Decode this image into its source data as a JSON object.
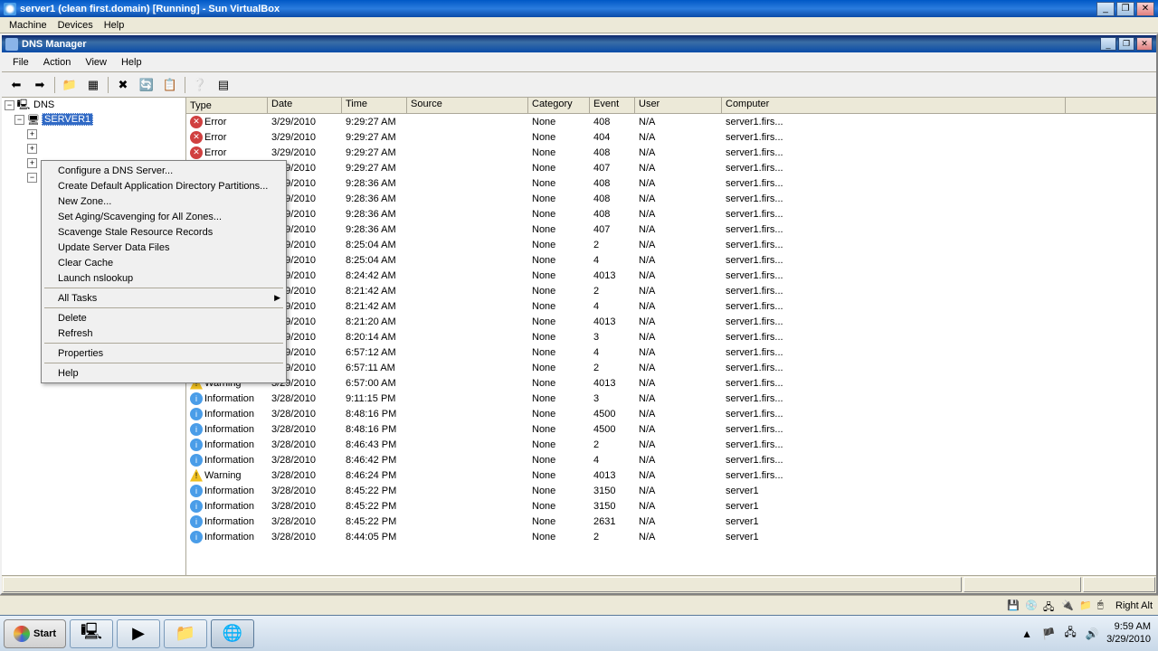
{
  "vbox": {
    "title": "server1 (clean first.domain) [Running] - Sun VirtualBox",
    "menu": {
      "machine": "Machine",
      "devices": "Devices",
      "help": "Help"
    },
    "status_key": "Right Alt"
  },
  "dns_window": {
    "title": "DNS Manager",
    "menu": {
      "file": "File",
      "action": "Action",
      "view": "View",
      "help": "Help"
    }
  },
  "tree": {
    "root": "DNS",
    "server": "SERVER1"
  },
  "context_menu": {
    "configure": "Configure a DNS Server...",
    "create_partitions": "Create Default Application Directory Partitions...",
    "new_zone": "New Zone...",
    "aging": "Set Aging/Scavenging for All Zones...",
    "scavenge": "Scavenge Stale Resource Records",
    "update": "Update Server Data Files",
    "clear_cache": "Clear Cache",
    "nslookup": "Launch nslookup",
    "all_tasks": "All Tasks",
    "delete": "Delete",
    "refresh": "Refresh",
    "properties": "Properties",
    "help": "Help"
  },
  "columns": {
    "type": "Type",
    "date": "Date",
    "time": "Time",
    "source": "Source",
    "category": "Category",
    "event": "Event",
    "user": "User",
    "computer": "Computer"
  },
  "type_labels": {
    "info": "Information",
    "warn": "Warning",
    "error": "Error"
  },
  "rows": [
    {
      "t": "error",
      "date": "3/29/2010",
      "time": "9:29:27 AM",
      "src": "",
      "cat": "None",
      "ev": "408",
      "u": "N/A",
      "c": "server1.firs..."
    },
    {
      "t": "error",
      "date": "3/29/2010",
      "time": "9:29:27 AM",
      "src": "",
      "cat": "None",
      "ev": "404",
      "u": "N/A",
      "c": "server1.firs..."
    },
    {
      "t": "error",
      "date": "3/29/2010",
      "time": "9:29:27 AM",
      "src": "",
      "cat": "None",
      "ev": "408",
      "u": "N/A",
      "c": "server1.firs..."
    },
    {
      "t": "error",
      "date": "3/29/2010",
      "time": "9:29:27 AM",
      "src": "",
      "cat": "None",
      "ev": "407",
      "u": "N/A",
      "c": "server1.firs..."
    },
    {
      "t": "error",
      "date": "3/29/2010",
      "time": "9:28:36 AM",
      "src": "",
      "cat": "None",
      "ev": "408",
      "u": "N/A",
      "c": "server1.firs..."
    },
    {
      "t": "error",
      "date": "3/29/2010",
      "time": "9:28:36 AM",
      "src": "",
      "cat": "None",
      "ev": "408",
      "u": "N/A",
      "c": "server1.firs..."
    },
    {
      "t": "error",
      "date": "3/29/2010",
      "time": "9:28:36 AM",
      "src": "",
      "cat": "None",
      "ev": "408",
      "u": "N/A",
      "c": "server1.firs..."
    },
    {
      "t": "error",
      "date": "3/29/2010",
      "time": "9:28:36 AM",
      "src": "",
      "cat": "None",
      "ev": "407",
      "u": "N/A",
      "c": "server1.firs..."
    },
    {
      "t": "info",
      "date": "3/29/2010",
      "time": "8:25:04 AM",
      "src": "",
      "cat": "None",
      "ev": "2",
      "u": "N/A",
      "c": "server1.firs..."
    },
    {
      "t": "info",
      "date": "3/29/2010",
      "time": "8:25:04 AM",
      "src": "",
      "cat": "None",
      "ev": "4",
      "u": "N/A",
      "c": "server1.firs..."
    },
    {
      "t": "warn",
      "date": "3/29/2010",
      "time": "8:24:42 AM",
      "src": "",
      "cat": "None",
      "ev": "4013",
      "u": "N/A",
      "c": "server1.firs..."
    },
    {
      "t": "info",
      "date": "3/29/2010",
      "time": "8:21:42 AM",
      "src": "",
      "cat": "None",
      "ev": "2",
      "u": "N/A",
      "c": "server1.firs..."
    },
    {
      "t": "info",
      "date": "3/29/2010",
      "time": "8:21:42 AM",
      "src": "",
      "cat": "None",
      "ev": "4",
      "u": "N/A",
      "c": "server1.firs..."
    },
    {
      "t": "warn",
      "date": "3/29/2010",
      "time": "8:21:20 AM",
      "src": "",
      "cat": "None",
      "ev": "4013",
      "u": "N/A",
      "c": "server1.firs..."
    },
    {
      "t": "info",
      "date": "3/29/2010",
      "time": "8:20:14 AM",
      "src": "",
      "cat": "None",
      "ev": "3",
      "u": "N/A",
      "c": "server1.firs..."
    },
    {
      "t": "info",
      "date": "3/29/2010",
      "time": "6:57:12 AM",
      "src": "",
      "cat": "None",
      "ev": "4",
      "u": "N/A",
      "c": "server1.firs..."
    },
    {
      "t": "info",
      "date": "3/29/2010",
      "time": "6:57:11 AM",
      "src": "",
      "cat": "None",
      "ev": "2",
      "u": "N/A",
      "c": "server1.firs..."
    },
    {
      "t": "warn",
      "date": "3/29/2010",
      "time": "6:57:00 AM",
      "src": "",
      "cat": "None",
      "ev": "4013",
      "u": "N/A",
      "c": "server1.firs..."
    },
    {
      "t": "info",
      "date": "3/28/2010",
      "time": "9:11:15 PM",
      "src": "",
      "cat": "None",
      "ev": "3",
      "u": "N/A",
      "c": "server1.firs..."
    },
    {
      "t": "info",
      "date": "3/28/2010",
      "time": "8:48:16 PM",
      "src": "",
      "cat": "None",
      "ev": "4500",
      "u": "N/A",
      "c": "server1.firs..."
    },
    {
      "t": "info",
      "date": "3/28/2010",
      "time": "8:48:16 PM",
      "src": "",
      "cat": "None",
      "ev": "4500",
      "u": "N/A",
      "c": "server1.firs..."
    },
    {
      "t": "info",
      "date": "3/28/2010",
      "time": "8:46:43 PM",
      "src": "",
      "cat": "None",
      "ev": "2",
      "u": "N/A",
      "c": "server1.firs..."
    },
    {
      "t": "info",
      "date": "3/28/2010",
      "time": "8:46:42 PM",
      "src": "",
      "cat": "None",
      "ev": "4",
      "u": "N/A",
      "c": "server1.firs..."
    },
    {
      "t": "warn",
      "date": "3/28/2010",
      "time": "8:46:24 PM",
      "src": "",
      "cat": "None",
      "ev": "4013",
      "u": "N/A",
      "c": "server1.firs..."
    },
    {
      "t": "info",
      "date": "3/28/2010",
      "time": "8:45:22 PM",
      "src": "",
      "cat": "None",
      "ev": "3150",
      "u": "N/A",
      "c": "server1"
    },
    {
      "t": "info",
      "date": "3/28/2010",
      "time": "8:45:22 PM",
      "src": "",
      "cat": "None",
      "ev": "3150",
      "u": "N/A",
      "c": "server1"
    },
    {
      "t": "info",
      "date": "3/28/2010",
      "time": "8:45:22 PM",
      "src": "",
      "cat": "None",
      "ev": "2631",
      "u": "N/A",
      "c": "server1"
    },
    {
      "t": "info",
      "date": "3/28/2010",
      "time": "8:44:05 PM",
      "src": "",
      "cat": "None",
      "ev": "2",
      "u": "N/A",
      "c": "server1"
    }
  ],
  "taskbar": {
    "start": "Start",
    "clock_time": "9:59 AM",
    "clock_date": "3/29/2010"
  }
}
